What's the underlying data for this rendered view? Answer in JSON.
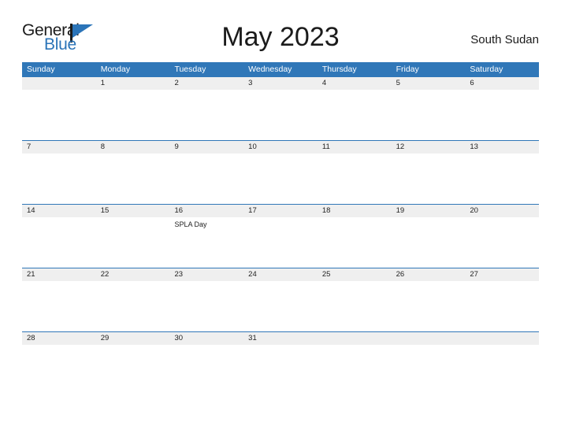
{
  "brand": {
    "word_one": "General",
    "word_two": "Blue",
    "flag_icon": "flag-triangle-icon",
    "accent_color": "#2b74b8"
  },
  "header": {
    "title": "May 2023",
    "country": "South Sudan"
  },
  "theme": {
    "header_blue": "#3077b8",
    "date_band_gray": "#efefef",
    "text_dark": "#1b1b1b",
    "page_background": "#ffffff"
  },
  "calendar": {
    "weekdays": [
      "Sunday",
      "Monday",
      "Tuesday",
      "Wednesday",
      "Thursday",
      "Friday",
      "Saturday"
    ],
    "weeks": [
      {
        "days": [
          {
            "number": "",
            "events": []
          },
          {
            "number": "1",
            "events": []
          },
          {
            "number": "2",
            "events": []
          },
          {
            "number": "3",
            "events": []
          },
          {
            "number": "4",
            "events": []
          },
          {
            "number": "5",
            "events": []
          },
          {
            "number": "6",
            "events": []
          }
        ]
      },
      {
        "days": [
          {
            "number": "7",
            "events": []
          },
          {
            "number": "8",
            "events": []
          },
          {
            "number": "9",
            "events": []
          },
          {
            "number": "10",
            "events": []
          },
          {
            "number": "11",
            "events": []
          },
          {
            "number": "12",
            "events": []
          },
          {
            "number": "13",
            "events": []
          }
        ]
      },
      {
        "days": [
          {
            "number": "14",
            "events": []
          },
          {
            "number": "15",
            "events": []
          },
          {
            "number": "16",
            "events": [
              "SPLA Day"
            ]
          },
          {
            "number": "17",
            "events": []
          },
          {
            "number": "18",
            "events": []
          },
          {
            "number": "19",
            "events": []
          },
          {
            "number": "20",
            "events": []
          }
        ]
      },
      {
        "days": [
          {
            "number": "21",
            "events": []
          },
          {
            "number": "22",
            "events": []
          },
          {
            "number": "23",
            "events": []
          },
          {
            "number": "24",
            "events": []
          },
          {
            "number": "25",
            "events": []
          },
          {
            "number": "26",
            "events": []
          },
          {
            "number": "27",
            "events": []
          }
        ]
      },
      {
        "days": [
          {
            "number": "28",
            "events": []
          },
          {
            "number": "29",
            "events": []
          },
          {
            "number": "30",
            "events": []
          },
          {
            "number": "31",
            "events": []
          },
          {
            "number": "",
            "events": []
          },
          {
            "number": "",
            "events": []
          },
          {
            "number": "",
            "events": []
          }
        ]
      }
    ]
  }
}
